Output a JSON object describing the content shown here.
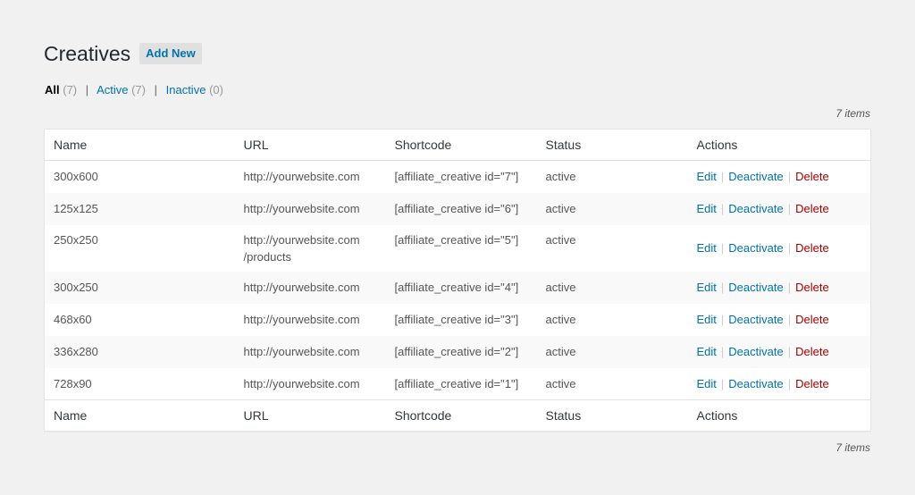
{
  "header": {
    "title": "Creatives",
    "add_new_label": "Add New"
  },
  "filters": {
    "all_label": "All",
    "all_count": "(7)",
    "active_label": "Active",
    "active_count": "(7)",
    "inactive_label": "Inactive",
    "inactive_count": "(0)",
    "separator": "|"
  },
  "pagination": {
    "items_text": "7 items"
  },
  "table": {
    "columns": [
      "Name",
      "URL",
      "Shortcode",
      "Status",
      "Actions"
    ],
    "rows": [
      {
        "name": "300x600",
        "url": "http://yourwebsite.com",
        "url2": "",
        "shortcode": "[affiliate_creative id=\"7\"]",
        "status": "active"
      },
      {
        "name": "125x125",
        "url": "http://yourwebsite.com",
        "url2": "",
        "shortcode": "[affiliate_creative id=\"6\"]",
        "status": "active"
      },
      {
        "name": "250x250",
        "url": "http://yourwebsite.com",
        "url2": "/products",
        "shortcode": "[affiliate_creative id=\"5\"]",
        "status": "active"
      },
      {
        "name": "300x250",
        "url": "http://yourwebsite.com",
        "url2": "",
        "shortcode": "[affiliate_creative id=\"4\"]",
        "status": "active"
      },
      {
        "name": "468x60",
        "url": "http://yourwebsite.com",
        "url2": "",
        "shortcode": "[affiliate_creative id=\"3\"]",
        "status": "active"
      },
      {
        "name": "336x280",
        "url": "http://yourwebsite.com",
        "url2": "",
        "shortcode": "[affiliate_creative id=\"2\"]",
        "status": "active"
      },
      {
        "name": "728x90",
        "url": "http://yourwebsite.com",
        "url2": "",
        "shortcode": "[affiliate_creative id=\"1\"]",
        "status": "active"
      }
    ],
    "actions": {
      "edit": "Edit",
      "deactivate": "Deactivate",
      "delete": "Delete",
      "separator": "|"
    }
  },
  "colors": {
    "link": "#0073aa",
    "delete": "#aa0000",
    "background": "#f1f1f1"
  }
}
